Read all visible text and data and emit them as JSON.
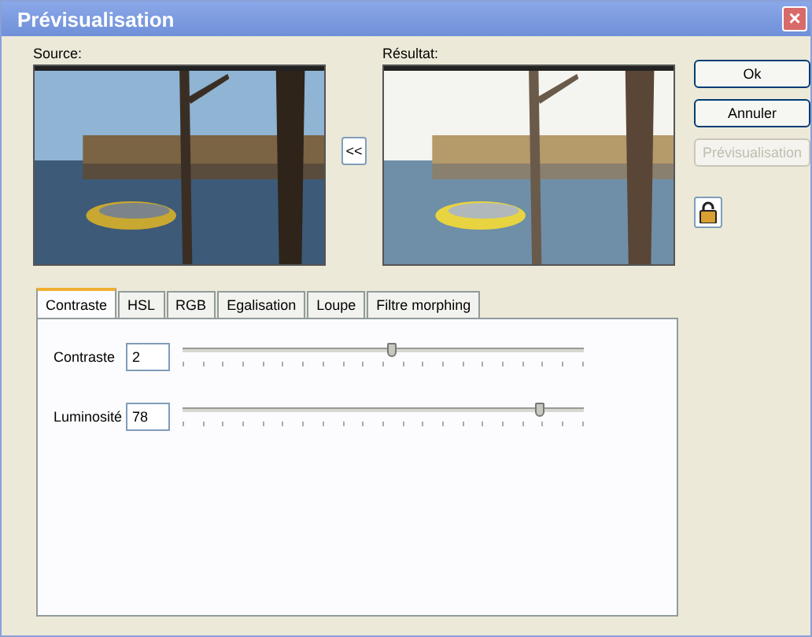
{
  "window": {
    "title": "Prévisualisation",
    "close": "×"
  },
  "source": {
    "label": "Source:"
  },
  "copy_button": "<<",
  "result": {
    "label": "Résultat:"
  },
  "buttons": [
    {
      "label": "Ok",
      "disabled": false
    },
    {
      "label": "Annuler",
      "disabled": false
    },
    {
      "label": "Prévisualisation",
      "disabled": true
    }
  ],
  "tabs": [
    {
      "label": "Contraste",
      "selected": true
    },
    {
      "label": "HSL",
      "selected": false
    },
    {
      "label": "RGB",
      "selected": false
    },
    {
      "label": "Egalisation",
      "selected": false
    },
    {
      "label": "Loupe",
      "selected": false
    },
    {
      "label": "Filtre morphing",
      "selected": false
    }
  ],
  "sliders": [
    {
      "label": "Contraste",
      "value": "2",
      "level": 0.52
    },
    {
      "label": "Luminosité",
      "value": "78",
      "level": 0.89
    }
  ]
}
